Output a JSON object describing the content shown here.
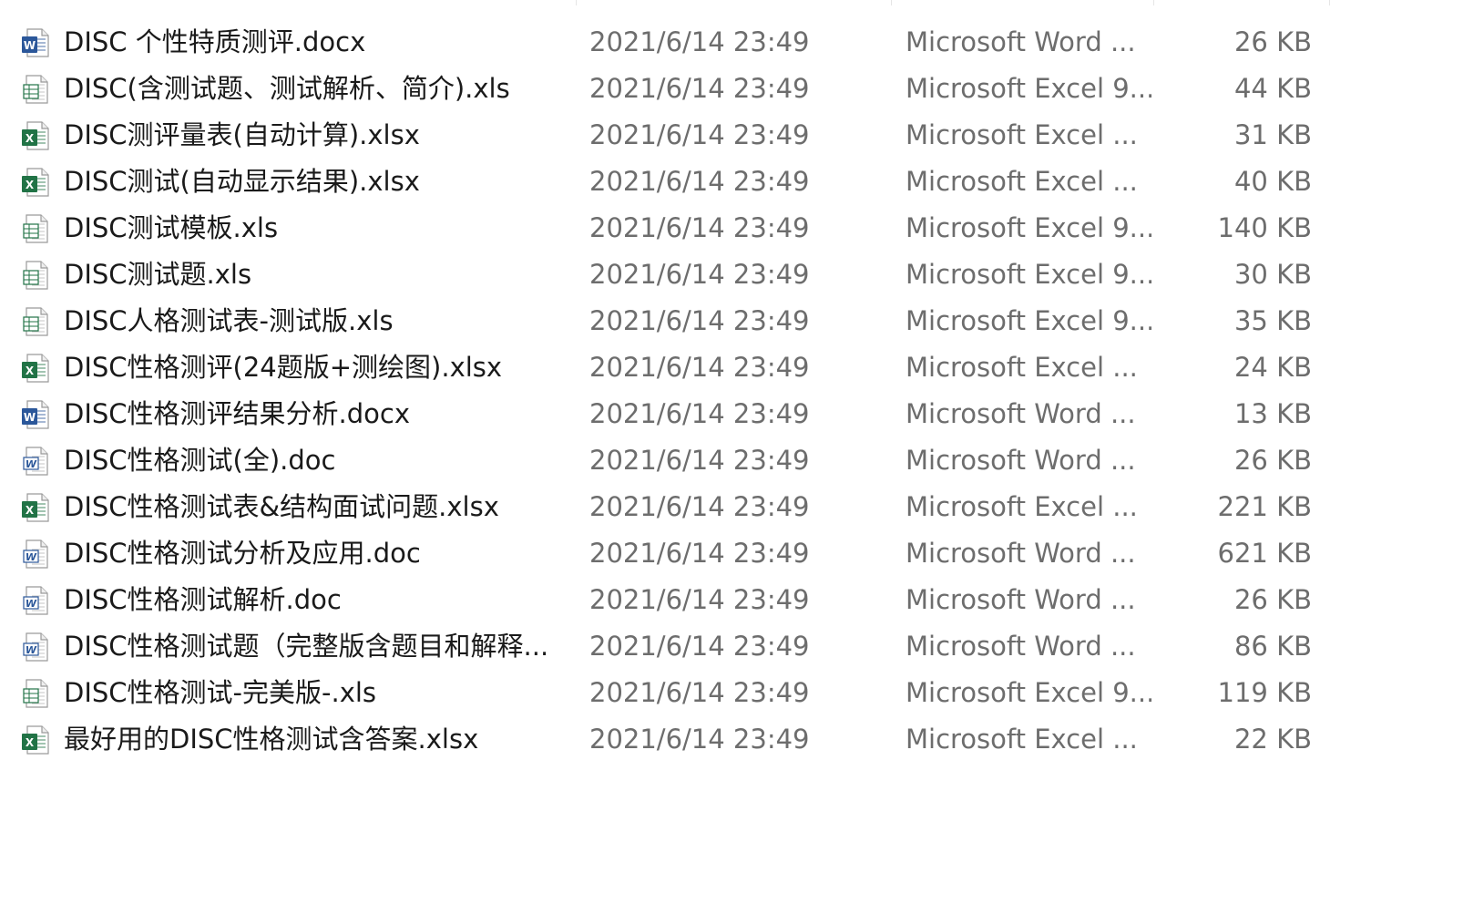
{
  "colors": {
    "word": "#2b579a",
    "excel": "#217346",
    "name_text": "#1a1a1a",
    "meta_text": "#6d6d6d"
  },
  "files": [
    {
      "name": "DISC 个性特质测评.docx",
      "date": "2021/6/14 23:49",
      "type": "Microsoft Word ...",
      "size": "26 KB",
      "icon": "word-docx-icon"
    },
    {
      "name": "DISC(含测试题、测试解析、简介).xls",
      "date": "2021/6/14 23:49",
      "type": "Microsoft Excel 9...",
      "size": "44 KB",
      "icon": "excel-xls-icon"
    },
    {
      "name": "DISC测评量表(自动计算).xlsx",
      "date": "2021/6/14 23:49",
      "type": "Microsoft Excel ...",
      "size": "31 KB",
      "icon": "excel-xlsx-icon"
    },
    {
      "name": "DISC测试(自动显示结果).xlsx",
      "date": "2021/6/14 23:49",
      "type": "Microsoft Excel ...",
      "size": "40 KB",
      "icon": "excel-xlsx-icon"
    },
    {
      "name": "DISC测试模板.xls",
      "date": "2021/6/14 23:49",
      "type": "Microsoft Excel 9...",
      "size": "140 KB",
      "icon": "excel-xls-icon"
    },
    {
      "name": "DISC测试题.xls",
      "date": "2021/6/14 23:49",
      "type": "Microsoft Excel 9...",
      "size": "30 KB",
      "icon": "excel-xls-icon"
    },
    {
      "name": "DISC人格测试表-测试版.xls",
      "date": "2021/6/14 23:49",
      "type": "Microsoft Excel 9...",
      "size": "35 KB",
      "icon": "excel-xls-icon"
    },
    {
      "name": "DISC性格测评(24题版+测绘图).xlsx",
      "date": "2021/6/14 23:49",
      "type": "Microsoft Excel ...",
      "size": "24 KB",
      "icon": "excel-xlsx-icon"
    },
    {
      "name": "DISC性格测评结果分析.docx",
      "date": "2021/6/14 23:49",
      "type": "Microsoft Word ...",
      "size": "13 KB",
      "icon": "word-docx-icon"
    },
    {
      "name": "DISC性格测试(全).doc",
      "date": "2021/6/14 23:49",
      "type": "Microsoft Word ...",
      "size": "26 KB",
      "icon": "word-doc-icon"
    },
    {
      "name": "DISC性格测试表&结构面试问题.xlsx",
      "date": "2021/6/14 23:49",
      "type": "Microsoft Excel ...",
      "size": "221 KB",
      "icon": "excel-xlsx-icon"
    },
    {
      "name": "DISC性格测试分析及应用.doc",
      "date": "2021/6/14 23:49",
      "type": "Microsoft Word ...",
      "size": "621 KB",
      "icon": "word-doc-icon"
    },
    {
      "name": "DISC性格测试解析.doc",
      "date": "2021/6/14 23:49",
      "type": "Microsoft Word ...",
      "size": "26 KB",
      "icon": "word-doc-icon"
    },
    {
      "name": "DISC性格测试题（完整版含题目和解释...",
      "date": "2021/6/14 23:49",
      "type": "Microsoft Word ...",
      "size": "86 KB",
      "icon": "word-doc-icon"
    },
    {
      "name": "DISC性格测试-完美版-.xls",
      "date": "2021/6/14 23:49",
      "type": "Microsoft Excel 9...",
      "size": "119 KB",
      "icon": "excel-xls-icon"
    },
    {
      "name": "最好用的DISC性格测试含答案.xlsx",
      "date": "2021/6/14 23:49",
      "type": "Microsoft Excel ...",
      "size": "22 KB",
      "icon": "excel-xlsx-icon"
    }
  ]
}
